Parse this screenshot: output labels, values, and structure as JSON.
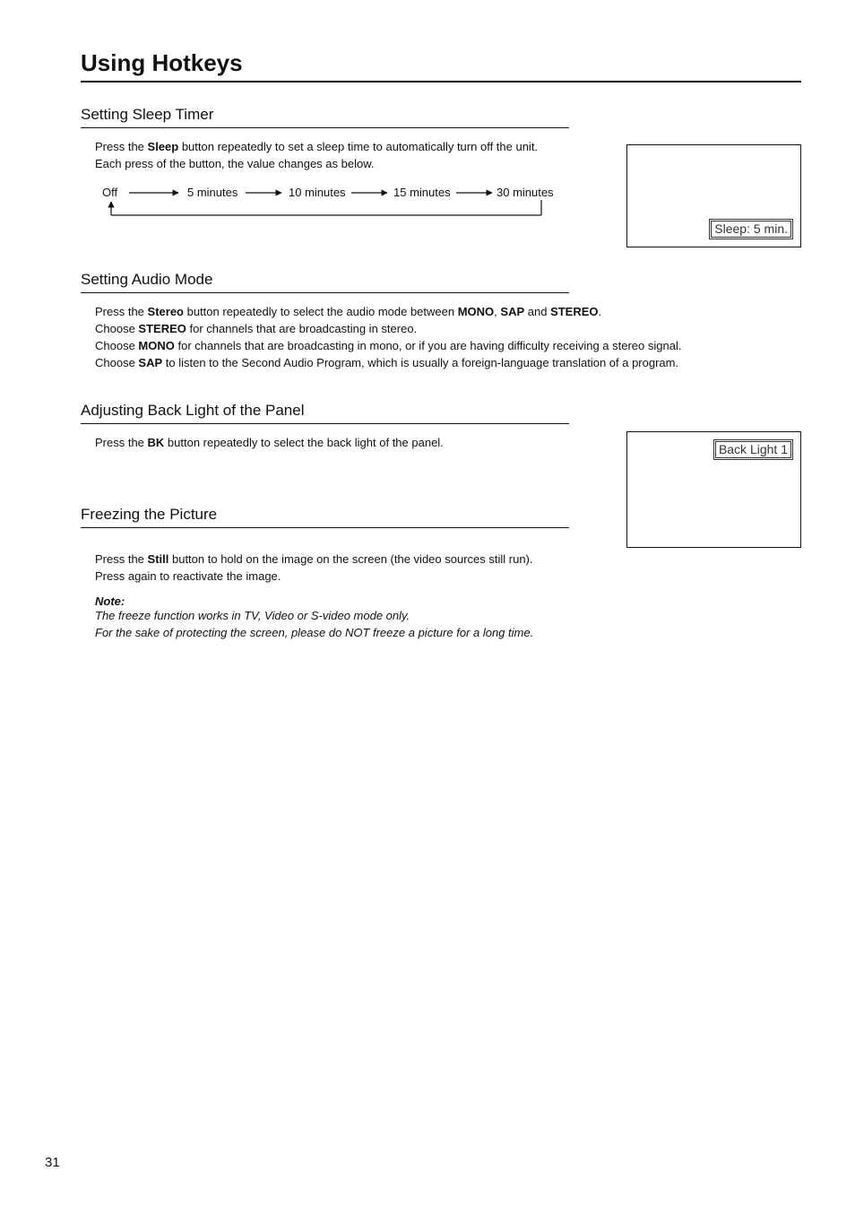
{
  "page_number": "31",
  "title": "Using Hotkeys",
  "sections": {
    "sleep": {
      "heading": "Setting Sleep Timer",
      "intro_pre": "Press the ",
      "intro_bold": "Sleep",
      "intro_post": " button repeatedly to set a sleep time to automatically turn off the unit. Each press of the button, the value changes as below.",
      "flow": {
        "off": "Off",
        "s1": "5 minutes",
        "s2": "10 minutes",
        "s3": "15 minutes",
        "s4": "30 minutes"
      },
      "osd": "Sleep: 5 min."
    },
    "audio": {
      "heading": "Setting Audio Mode",
      "p1_pre": "Press the ",
      "p1_b1": "Stereo",
      "p1_mid1": " button repeatedly to select the audio mode between ",
      "p1_b2": "MONO",
      "p1_mid2": ", ",
      "p1_b3": "SAP",
      "p1_mid3": " and ",
      "p1_b4": "STEREO",
      "p1_end": ".",
      "p2_pre": "Choose ",
      "p2_b": "STEREO",
      "p2_post": " for channels that are broadcasting in stereo.",
      "p3_pre": "Choose ",
      "p3_b": "MONO",
      "p3_post": " for channels that are broadcasting in mono, or if you are having difficulty receiving a stereo signal.",
      "p4_pre": "Choose ",
      "p4_b": "SAP",
      "p4_post": " to listen to the Second Audio Program, which is usually a foreign-language translation of a program."
    },
    "backlight": {
      "heading": "Adjusting Back Light of the Panel",
      "p_pre": "Press the ",
      "p_b": "BK",
      "p_post": " button repeatedly to select the back light of the panel.",
      "osd": "Back Light  1"
    },
    "freeze": {
      "heading": "Freezing the Picture",
      "p1_pre": "Press the ",
      "p1_b": "Still",
      "p1_post": " button to hold on the image on the screen (the video sources still run).",
      "p2": "Press again to reactivate the image.",
      "note_label": "Note:",
      "note_l1": "The freeze function works in TV, Video or S-video mode only.",
      "note_l2": "For the sake of protecting the screen, please do NOT freeze a picture for a long time."
    }
  }
}
